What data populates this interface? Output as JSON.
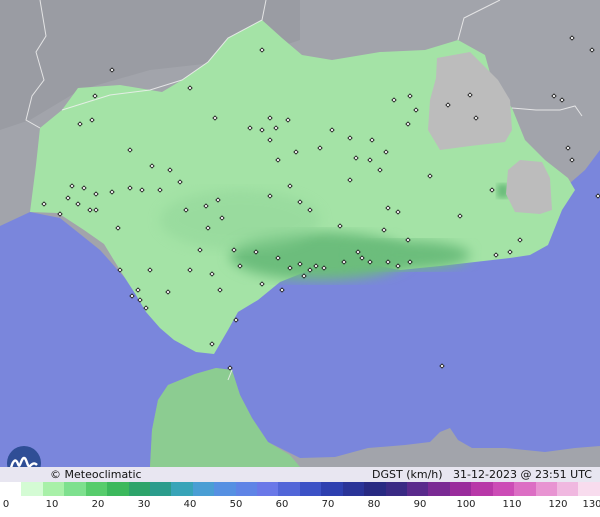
{
  "header": {
    "brand": "© Meteoclimatic",
    "product": "DGST (km/h)",
    "date": "31-12-2023",
    "at": "@",
    "time": "23:51 UTC"
  },
  "legend": {
    "labels": [
      "0",
      "10",
      "20",
      "30",
      "40",
      "50",
      "60",
      "70",
      "80",
      "90",
      "100",
      "110",
      "120",
      "130"
    ],
    "colors": [
      "#ffffff",
      "#d4fbd4",
      "#a8f0a8",
      "#7ee08e",
      "#57cc6c",
      "#3cb85c",
      "#2ea46a",
      "#2b9c8c",
      "#38a4b8",
      "#4a9ed4",
      "#5690e2",
      "#5f84e6",
      "#6a78e8",
      "#5266d8",
      "#3c52c6",
      "#2e40b0",
      "#2a3498",
      "#282a82",
      "#3a2a84",
      "#5a2a8c",
      "#7a2a94",
      "#9a2c9c",
      "#b838a8",
      "#cc4cb6",
      "#dc6ec4",
      "#e894d2",
      "#f0b8e0",
      "#f8dcee"
    ]
  },
  "map": {
    "colors": {
      "sea": "#7a86dc",
      "land_outside": "#a2a4ab",
      "land_outside_high": "#8c8e96",
      "andalusia_low": "#a4e3a6",
      "andalusia_mid": "#8fd497",
      "coast_gusts": "#6cbd7c",
      "mountain_gray": "#bcbcbc",
      "morocco_gusts": "#8ccc91",
      "station": "#ffffff",
      "border": "#f0f0f0"
    }
  }
}
